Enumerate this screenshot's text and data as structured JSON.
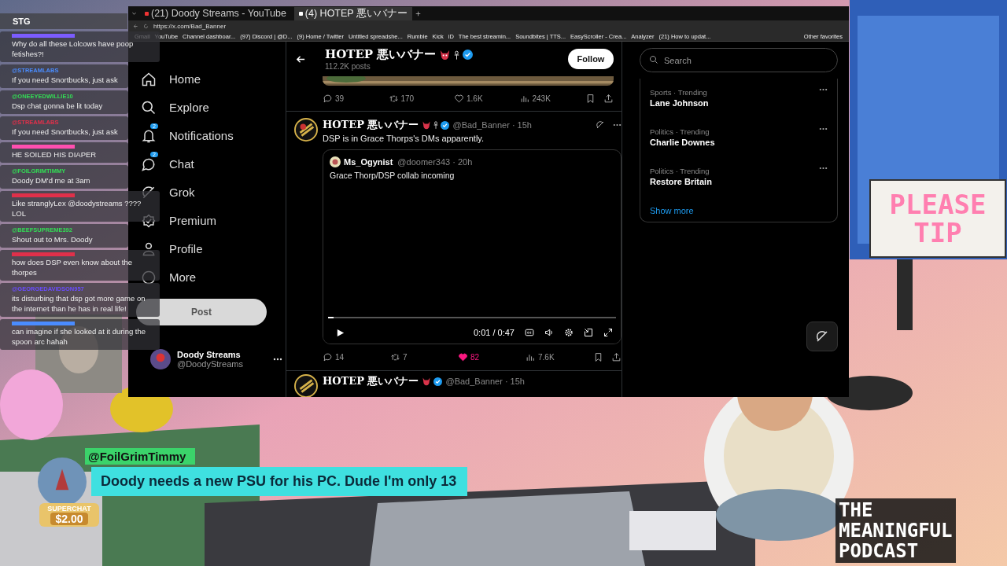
{
  "browser": {
    "tabs": [
      {
        "title": "(21) Doody Streams - YouTube",
        "selected": false
      },
      {
        "title": "(4) HOTEP 悪いバナー",
        "selected": true
      }
    ],
    "url": "https://x.com/Bad_Banner",
    "bookmarks": [
      "Gmail",
      "YouTube",
      "Channel dashboar...",
      "(97) Discord | @D...",
      "(9) Home / Twitter",
      "Untitled spreadshe...",
      "Rumble",
      "Kick",
      "iD",
      "The best streamin...",
      "Soundbites | TTS...",
      "EasyScroller - Crea...",
      "Analyzer",
      "(21) How to updat..."
    ],
    "other_bookmarks": "Other favorites"
  },
  "nav": {
    "items": [
      {
        "kind": "home",
        "label": "Home"
      },
      {
        "kind": "explore",
        "label": "Explore"
      },
      {
        "kind": "notifications",
        "label": "Notifications",
        "badge": "2"
      },
      {
        "kind": "chat",
        "label": "Chat",
        "badge": "2"
      },
      {
        "kind": "grok",
        "label": "Grok"
      },
      {
        "kind": "premium",
        "label": "Premium"
      },
      {
        "kind": "profile",
        "label": "Profile"
      },
      {
        "kind": "more",
        "label": "More"
      }
    ],
    "post_button": "Post",
    "account": {
      "name": "Doody Streams",
      "handle": "@DoodyStreams"
    }
  },
  "profile_header": {
    "name": "HOTEP 悪いバナー",
    "posts": "112.2K posts",
    "follow": "Follow"
  },
  "first_post_stats": [
    {
      "kind": "reply",
      "count": "39",
      "liked": false
    },
    {
      "kind": "repost",
      "count": "170",
      "liked": false
    },
    {
      "kind": "like",
      "count": "1.6K",
      "liked": false
    },
    {
      "kind": "views",
      "count": "243K",
      "liked": false
    }
  ],
  "post": {
    "name": "HOTEP 悪いバナー",
    "handle": "@Bad_Banner · 15h",
    "text": "DSP is in Grace Thorps's DMs apparently.",
    "quote": {
      "name": "Ms_Ogynist",
      "handle": "@doomer343 · 20h",
      "text": "Grace Thorp/DSP collab incoming",
      "video": {
        "time": "0:01 / 0:47",
        "level": 0.02
      }
    },
    "stats": [
      {
        "kind": "reply",
        "count": "14",
        "liked": false
      },
      {
        "kind": "repost",
        "count": "7",
        "liked": false
      },
      {
        "kind": "like",
        "count": "82",
        "liked": true
      },
      {
        "kind": "views",
        "count": "7.6K",
        "liked": false
      }
    ]
  },
  "next_post": {
    "name": "HOTEP 悪いバナー",
    "handle": "@Bad_Banner · 15h"
  },
  "search": {
    "placeholder": "Search"
  },
  "trends": [
    {
      "category": "Sports · Trending",
      "name": "Lane Johnson"
    },
    {
      "category": "Politics · Trending",
      "name": "Charlie Downes"
    },
    {
      "category": "Politics · Trending",
      "name": "Restore Britain"
    }
  ],
  "show_more": "Show more",
  "chat": {
    "title": "STG",
    "messages": [
      {
        "color": "#7b5cff",
        "text": "Why do all these Lolcows have poop fetishes?!"
      },
      {
        "user": "@STREAMLABS",
        "color": "#4a8cff",
        "text": "If you need Snortbucks, just ask"
      },
      {
        "user": "@ONEEYEDWILLIE10",
        "color": "#33dd55",
        "text": "Dsp chat gonna be lit today"
      },
      {
        "user": "@STREAMLABS",
        "color": "#e0304a",
        "text": "If you need Snortbucks, just ask"
      },
      {
        "color": "#ff4fb0",
        "text": "HE SOILED HIS DIAPER"
      },
      {
        "user": "@FOILGRIMTIMMY",
        "color": "#33dd55",
        "text": "Doody DM'd me at 3am"
      },
      {
        "color": "#e0304a",
        "text": "Like stranglyLex @doodystreams ???? LOL"
      },
      {
        "user": "@BEEFSUPREME392",
        "color": "#33dd55",
        "text": "Shout out to Mrs. Doody"
      },
      {
        "color": "#e0304a",
        "text": "how does DSP even know about the thorpes"
      },
      {
        "user": "@GEORGEDAVIDSON957",
        "color": "#6a4cff",
        "text": "its disturbing that dsp got more game on the internet than he has in real life!"
      },
      {
        "color": "#4a8cff",
        "text": "can imagine if she looked at it during the spoon arc hahah"
      }
    ]
  },
  "superchat": {
    "user": "@FoilGrimTimmy",
    "message": "Doody needs a new PSU for his PC. Dude I'm only 13",
    "label": "SUPERCHAT",
    "amount": "$2.00"
  },
  "tip_sign": [
    "PLEASE",
    "TIP"
  ],
  "logo": [
    "THE",
    "MEANINGFUL",
    "PODCAST"
  ]
}
